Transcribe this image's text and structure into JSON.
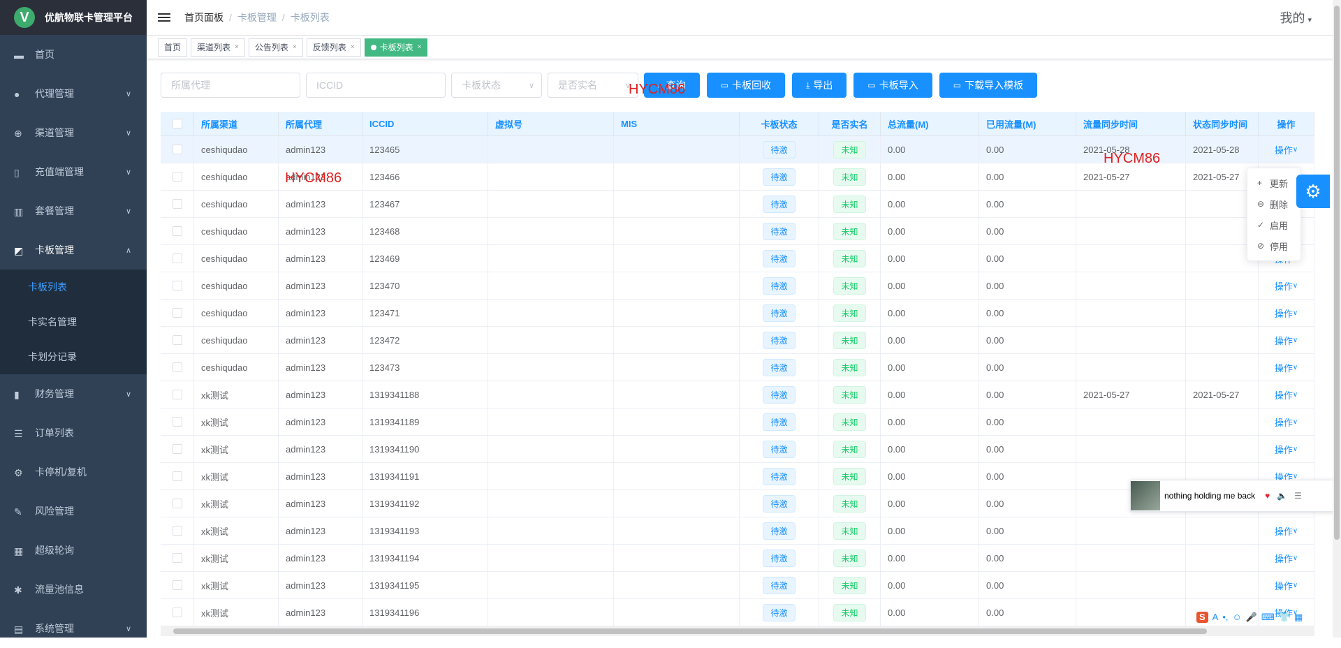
{
  "app": {
    "logo_letter": "V",
    "title": "优航物联卡管理平台"
  },
  "sidebar": {
    "items": [
      {
        "label": "首页",
        "icon": "monitor-icon"
      },
      {
        "label": "代理管理",
        "icon": "user-icon",
        "arrow": "∨"
      },
      {
        "label": "渠道管理",
        "icon": "plus-circle-icon",
        "arrow": "∨"
      },
      {
        "label": "充值端管理",
        "icon": "phone-icon",
        "arrow": "∨"
      },
      {
        "label": "套餐管理",
        "icon": "chart-bar-icon",
        "arrow": "∨"
      },
      {
        "label": "卡板管理",
        "icon": "line-chart-icon",
        "arrow": "∧"
      }
    ],
    "sub_items": [
      {
        "label": "卡板列表",
        "active": true
      },
      {
        "label": "卡实名管理"
      },
      {
        "label": "卡划分记录"
      }
    ],
    "items_after": [
      {
        "label": "财务管理",
        "icon": "bar-chart-icon",
        "arrow": "∨"
      },
      {
        "label": "订单列表",
        "icon": "list-icon"
      },
      {
        "label": "卡停机/复机",
        "icon": "gear-icon"
      },
      {
        "label": "风险管理",
        "icon": "edit-icon"
      },
      {
        "label": "超级轮询",
        "icon": "calendar-icon"
      },
      {
        "label": "流量池信息",
        "icon": "bug-icon"
      },
      {
        "label": "系统管理",
        "icon": "book-icon",
        "arrow": "∨"
      }
    ]
  },
  "header": {
    "breadcrumb": [
      "首页面板",
      "卡板管理",
      "卡板列表"
    ],
    "user_label": "我的",
    "user_caret": "▾"
  },
  "tags": [
    {
      "label": "首页",
      "closable": false
    },
    {
      "label": "渠道列表",
      "closable": true
    },
    {
      "label": "公告列表",
      "closable": true
    },
    {
      "label": "反馈列表",
      "closable": true
    },
    {
      "label": "卡板列表",
      "closable": true,
      "active": true
    }
  ],
  "tag_close": "×",
  "filters": {
    "agent_placeholder": "所属代理",
    "iccid_placeholder": "ICCID",
    "status_placeholder": "卡板状态",
    "realname_placeholder": "是否实名"
  },
  "buttons": {
    "query": "查询",
    "recycle": "卡板回收",
    "export": "导出",
    "import": "卡板导入",
    "download_template": "下载导入模板"
  },
  "table": {
    "columns": [
      "所属渠道",
      "所属代理",
      "ICCID",
      "虚拟号",
      "MIS",
      "卡板状态",
      "是否实名",
      "总流量(M)",
      "已用流量(M)",
      "流量同步时间",
      "状态同步时间",
      "操作"
    ],
    "rows": [
      {
        "channel": "ceshiqudao",
        "agent": "admin123",
        "iccid": "123465",
        "virtual": "",
        "mis": "",
        "status": "待激",
        "realname": "未知",
        "total": "0.00",
        "used": "0.00",
        "flow_sync": "2021-05-28",
        "state_sync": "2021-05-28",
        "op": "操作"
      },
      {
        "channel": "ceshiqudao",
        "agent": "admin123",
        "iccid": "123466",
        "virtual": "",
        "mis": "",
        "status": "待激",
        "realname": "未知",
        "total": "0.00",
        "used": "0.00",
        "flow_sync": "2021-05-27",
        "state_sync": "2021-05-27",
        "op": ""
      },
      {
        "channel": "ceshiqudao",
        "agent": "admin123",
        "iccid": "123467",
        "virtual": "",
        "mis": "",
        "status": "待激",
        "realname": "未知",
        "total": "0.00",
        "used": "0.00",
        "flow_sync": "",
        "state_sync": "",
        "op": ""
      },
      {
        "channel": "ceshiqudao",
        "agent": "admin123",
        "iccid": "123468",
        "virtual": "",
        "mis": "",
        "status": "待激",
        "realname": "未知",
        "total": "0.00",
        "used": "0.00",
        "flow_sync": "",
        "state_sync": "",
        "op": ""
      },
      {
        "channel": "ceshiqudao",
        "agent": "admin123",
        "iccid": "123469",
        "virtual": "",
        "mis": "",
        "status": "待激",
        "realname": "未知",
        "total": "0.00",
        "used": "0.00",
        "flow_sync": "",
        "state_sync": "",
        "op": "操作"
      },
      {
        "channel": "ceshiqudao",
        "agent": "admin123",
        "iccid": "123470",
        "virtual": "",
        "mis": "",
        "status": "待激",
        "realname": "未知",
        "total": "0.00",
        "used": "0.00",
        "flow_sync": "",
        "state_sync": "",
        "op": "操作"
      },
      {
        "channel": "ceshiqudao",
        "agent": "admin123",
        "iccid": "123471",
        "virtual": "",
        "mis": "",
        "status": "待激",
        "realname": "未知",
        "total": "0.00",
        "used": "0.00",
        "flow_sync": "",
        "state_sync": "",
        "op": "操作"
      },
      {
        "channel": "ceshiqudao",
        "agent": "admin123",
        "iccid": "123472",
        "virtual": "",
        "mis": "",
        "status": "待激",
        "realname": "未知",
        "total": "0.00",
        "used": "0.00",
        "flow_sync": "",
        "state_sync": "",
        "op": "操作"
      },
      {
        "channel": "ceshiqudao",
        "agent": "admin123",
        "iccid": "123473",
        "virtual": "",
        "mis": "",
        "status": "待激",
        "realname": "未知",
        "total": "0.00",
        "used": "0.00",
        "flow_sync": "",
        "state_sync": "",
        "op": "操作"
      },
      {
        "channel": "xk测试",
        "agent": "admin123",
        "iccid": "1319341188",
        "virtual": "",
        "mis": "",
        "status": "待激",
        "realname": "未知",
        "total": "0.00",
        "used": "0.00",
        "flow_sync": "2021-05-27",
        "state_sync": "2021-05-27",
        "op": "操作"
      },
      {
        "channel": "xk测试",
        "agent": "admin123",
        "iccid": "1319341189",
        "virtual": "",
        "mis": "",
        "status": "待激",
        "realname": "未知",
        "total": "0.00",
        "used": "0.00",
        "flow_sync": "",
        "state_sync": "",
        "op": "操作"
      },
      {
        "channel": "xk测试",
        "agent": "admin123",
        "iccid": "1319341190",
        "virtual": "",
        "mis": "",
        "status": "待激",
        "realname": "未知",
        "total": "0.00",
        "used": "0.00",
        "flow_sync": "",
        "state_sync": "",
        "op": "操作"
      },
      {
        "channel": "xk测试",
        "agent": "admin123",
        "iccid": "1319341191",
        "virtual": "",
        "mis": "",
        "status": "待激",
        "realname": "未知",
        "total": "0.00",
        "used": "0.00",
        "flow_sync": "",
        "state_sync": "",
        "op": "操作"
      },
      {
        "channel": "xk测试",
        "agent": "admin123",
        "iccid": "1319341192",
        "virtual": "",
        "mis": "",
        "status": "待激",
        "realname": "未知",
        "total": "0.00",
        "used": "0.00",
        "flow_sync": "",
        "state_sync": "",
        "op": "操作"
      },
      {
        "channel": "xk测试",
        "agent": "admin123",
        "iccid": "1319341193",
        "virtual": "",
        "mis": "",
        "status": "待激",
        "realname": "未知",
        "total": "0.00",
        "used": "0.00",
        "flow_sync": "",
        "state_sync": "",
        "op": "操作"
      },
      {
        "channel": "xk测试",
        "agent": "admin123",
        "iccid": "1319341194",
        "virtual": "",
        "mis": "",
        "status": "待激",
        "realname": "未知",
        "total": "0.00",
        "used": "0.00",
        "flow_sync": "",
        "state_sync": "",
        "op": "操作"
      },
      {
        "channel": "xk测试",
        "agent": "admin123",
        "iccid": "1319341195",
        "virtual": "",
        "mis": "",
        "status": "待激",
        "realname": "未知",
        "total": "0.00",
        "used": "0.00",
        "flow_sync": "",
        "state_sync": "",
        "op": "操作"
      },
      {
        "channel": "xk测试",
        "agent": "admin123",
        "iccid": "1319341196",
        "virtual": "",
        "mis": "",
        "status": "待激",
        "realname": "未知",
        "total": "0.00",
        "used": "0.00",
        "flow_sync": "",
        "state_sync": "",
        "op": "操作"
      }
    ]
  },
  "dropdown": [
    {
      "label": "更新",
      "icon": "plus-icon",
      "glyph": "+"
    },
    {
      "label": "删除",
      "icon": "minus-circle-icon",
      "glyph": "⊖"
    },
    {
      "label": "启用",
      "icon": "check-icon",
      "glyph": "✓"
    },
    {
      "label": "停用",
      "icon": "check-circle-icon",
      "glyph": "⊘"
    }
  ],
  "music": {
    "title": "nothing holding me back",
    "heart": "♥",
    "volume": "🔈",
    "list": "☰",
    "close": "×"
  },
  "watermark": "HYCM86",
  "ime": {
    "logo": "S",
    "items": [
      "A",
      "•,",
      "☺",
      "🎤",
      "⌨",
      "👕",
      "▦"
    ]
  },
  "colors": {
    "sidebar_bg": "#304156",
    "primary": "#1890ff",
    "tag_active": "#42b983"
  }
}
